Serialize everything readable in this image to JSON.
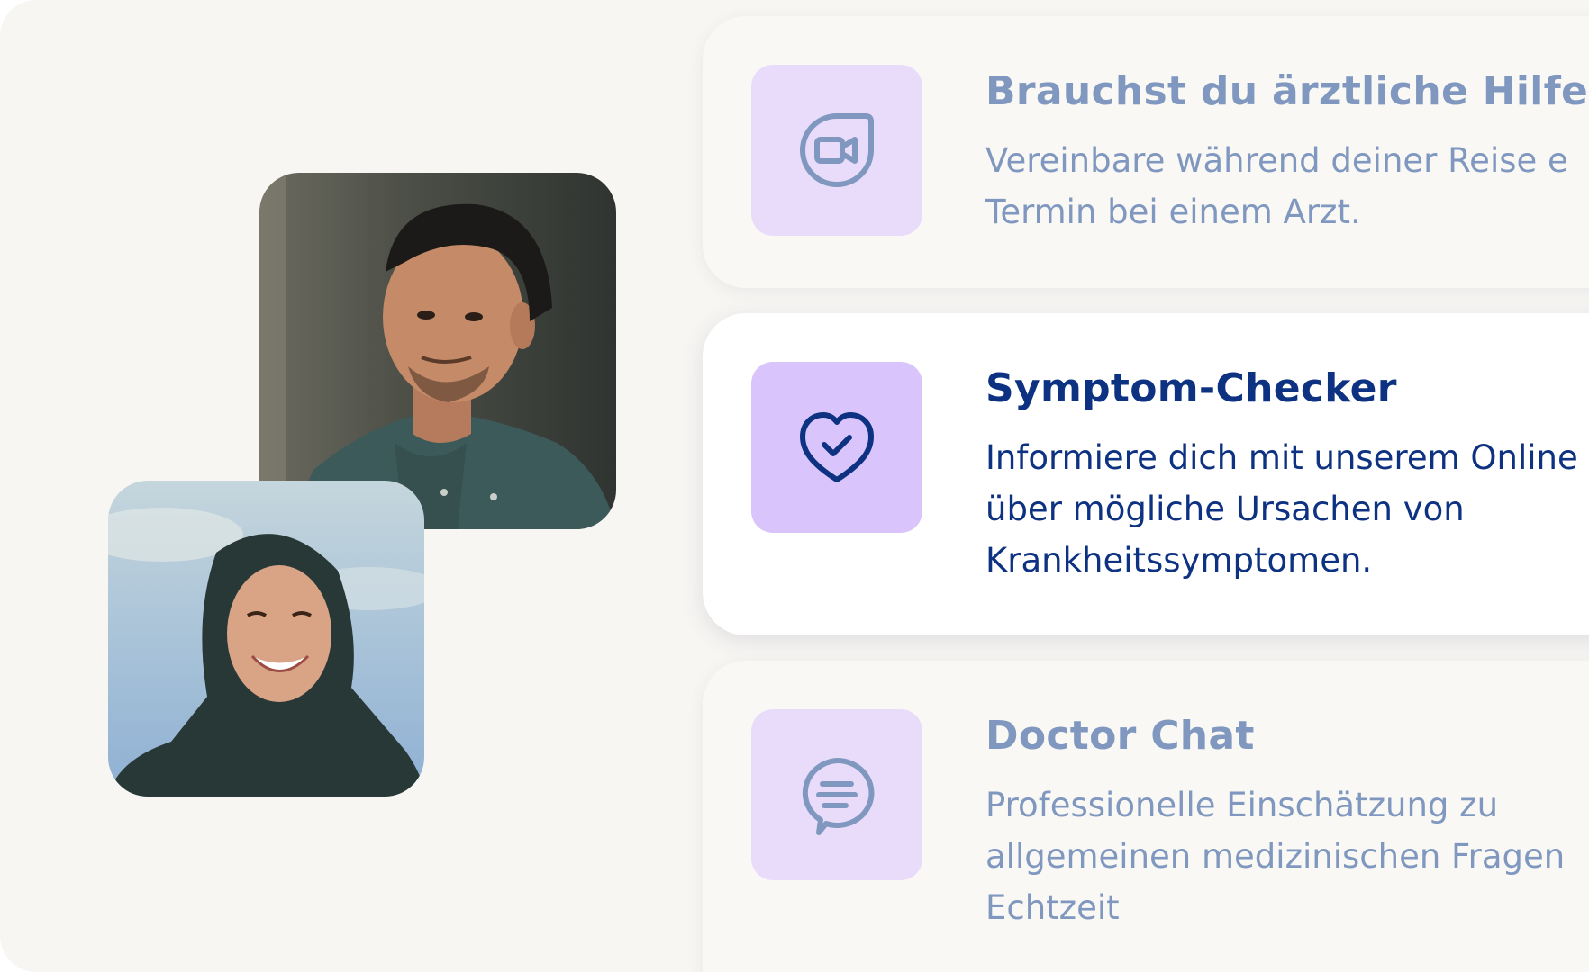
{
  "colors": {
    "panel_bg": "#f7f6f3",
    "muted_text": "#8098bf",
    "active_text": "#0e3282",
    "icon_tile_muted": "#e9dcfb",
    "icon_tile_active": "#d9c5fb"
  },
  "photos": [
    {
      "subject": "smiling man with dark hair in a blue denim shirt"
    },
    {
      "subject": "smiling woman wearing a dark headscarf against a blue sky"
    }
  ],
  "features": [
    {
      "icon": "video-call-icon",
      "title": "Brauchst du ärztliche Hilfe?",
      "description_lines": [
        "Vereinbare während deiner Reise e",
        "Termin bei einem Arzt."
      ],
      "active": false
    },
    {
      "icon": "heart-check-icon",
      "title": "Symptom-Checker",
      "description_lines": [
        "Informiere dich mit unserem Online",
        "über mögliche Ursachen von",
        "Krankheitssymptomen."
      ],
      "active": true
    },
    {
      "icon": "chat-bubble-icon",
      "title": "Doctor Chat",
      "description_lines": [
        "Professionelle Einschätzung zu",
        "allgemeinen medizinischen Fragen",
        "Echtzeit"
      ],
      "active": false
    }
  ]
}
